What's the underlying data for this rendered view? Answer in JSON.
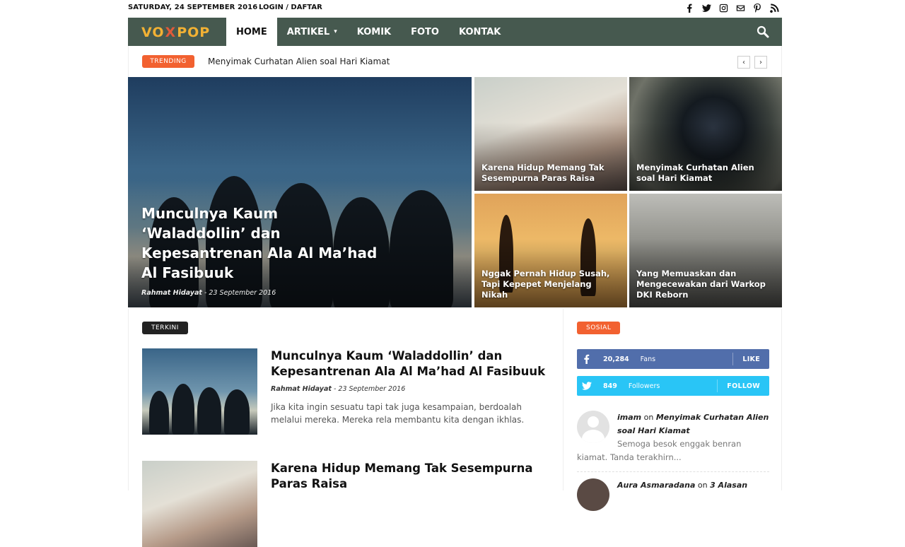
{
  "topbar": {
    "date": "SATURDAY, 24 SEPTEMBER 2016",
    "login": "LOGIN / DAFTAR",
    "social_icons": [
      "facebook-icon",
      "twitter-icon",
      "instagram-icon",
      "mail-icon",
      "pinterest-icon",
      "rss-icon"
    ]
  },
  "nav": {
    "logo_parts": [
      "VO",
      "X",
      "P",
      "OP"
    ],
    "items": [
      {
        "label": "HOME"
      },
      {
        "label": "ARTIKEL"
      },
      {
        "label": "KOMIK"
      },
      {
        "label": "FOTO"
      },
      {
        "label": "KONTAK"
      }
    ],
    "caret": "▾"
  },
  "trending": {
    "badge": "TRENDING",
    "title": "Menyimak Curhatan Alien soal Hari Kiamat",
    "prev": "‹",
    "next": "›"
  },
  "featured": {
    "big": {
      "title": "Munculnya Kaum ‘Waladdollin’ dan Kepesantrenan Ala Al Ma’had Al Fasibuuk",
      "author": "Rahmat Hidayat",
      "sep": "-",
      "date": "23 September 2016"
    },
    "tiles": [
      {
        "title": "Karena Hidup Memang Tak Sesempurna Paras Raisa"
      },
      {
        "title": "Menyimak Curhatan Alien soal Hari Kiamat"
      },
      {
        "title": "Nggak Pernah Hidup Susah, Tapi Kepepet Menjelang Nikah"
      },
      {
        "title": "Yang Memuaskan dan Mengecewakan dari Warkop DKI Reborn"
      }
    ]
  },
  "terkini": {
    "label": "TERKINI",
    "posts": [
      {
        "title": "Munculnya Kaum ‘Waladdollin’ dan Kepesantrenan Ala Al Ma’had Al Fasibuuk",
        "author": "Rahmat Hidayat",
        "sep": "-",
        "date": "23 September 2016",
        "excerpt": "Jika kita ingin sesuatu tapi tak juga kesampaian, berdoalah melalui mereka. Mereka rela membantu kita dengan ikhlas."
      },
      {
        "title": "Karena Hidup Memang Tak Sesempurna Paras Raisa"
      }
    ]
  },
  "sidebar": {
    "label": "SOSIAL",
    "facebook": {
      "count": "20,284",
      "label": "Fans",
      "action": "LIKE"
    },
    "twitter": {
      "count": "849",
      "label": "Followers",
      "action": "FOLLOW"
    },
    "comments": [
      {
        "user": "imam",
        "on": "on",
        "post": "Menyimak Curhatan Alien soal Hari Kiamat",
        "text": "Semoga besok enggak benran kiamat. Tanda terakhirn..."
      },
      {
        "user": "Aura Asmaradana",
        "on": "on",
        "post": "3 Alasan"
      }
    ]
  }
}
